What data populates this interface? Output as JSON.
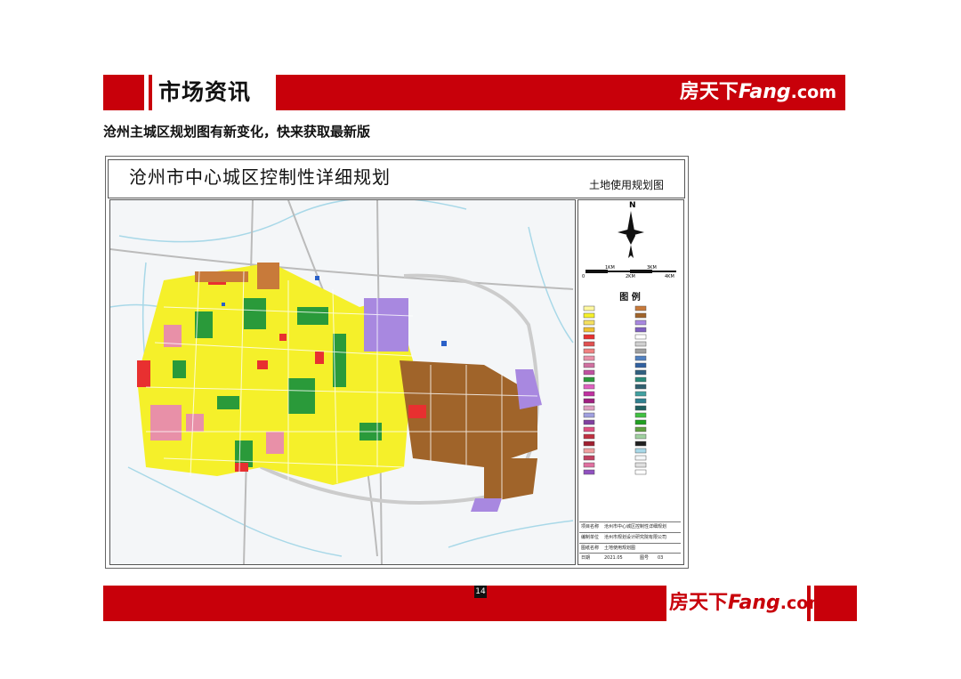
{
  "header": {
    "section_title": "市场资讯",
    "logo_cn": "房天下",
    "logo_en": "Fang",
    "logo_suffix": ".com"
  },
  "subtitle": "沧州主城区规划图有新变化，快来获取最新版",
  "map": {
    "title": "沧州市中心城区控制性详细规划",
    "subtitle": "土地使用规划图",
    "north_label": "N",
    "scale_labels": [
      "0",
      "1KM",
      "2KM",
      "3KM",
      "4KM"
    ],
    "legend_title": "图  例",
    "info_rows": [
      {
        "label": "项目名称",
        "value": "沧州市中心城区控制性详细规划"
      },
      {
        "label": "编制单位",
        "value": "沧州市规划设计研究院有限公司"
      },
      {
        "label": "图纸名称",
        "value": "土地使用规划图"
      },
      {
        "label": "日期",
        "value": "2021.05",
        "label2": "图号",
        "value2": "03"
      }
    ]
  },
  "footer": {
    "page_number": "14",
    "logo_cn": "房天下",
    "logo_en": "Fang",
    "logo_suffix": ".com"
  },
  "colors": {
    "brand_red": "#c8000a",
    "residential_yellow": "#f5f02a",
    "industrial_brown": "#a0642a",
    "commercial_red": "#e83030",
    "green_space": "#2a9a3a",
    "education_pink": "#e890a8",
    "logistics_purple": "#a888e0"
  }
}
